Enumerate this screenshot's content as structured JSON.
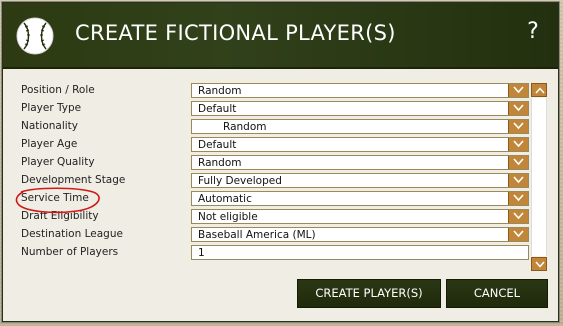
{
  "dialog": {
    "title": "CREATE FICTIONAL PLAYER(S)",
    "help_label": "?"
  },
  "fields": [
    {
      "label": "Position / Role",
      "value": "Random",
      "kind": "select"
    },
    {
      "label": "Player Type",
      "value": "Default",
      "kind": "select"
    },
    {
      "label": "Nationality",
      "value": "Random",
      "kind": "select"
    },
    {
      "label": "Player Age",
      "value": "Default",
      "kind": "select"
    },
    {
      "label": "Player Quality",
      "value": "Random",
      "kind": "select"
    },
    {
      "label": "Development Stage",
      "value": "Fully Developed",
      "kind": "select"
    },
    {
      "label": "Service Time",
      "value": "Automatic",
      "kind": "select"
    },
    {
      "label": "Draft Eligibility",
      "value": "Not eligible",
      "kind": "select"
    },
    {
      "label": "Destination League",
      "value": "Baseball America (ML)",
      "kind": "select"
    },
    {
      "label": "Number of Players",
      "value": "1",
      "kind": "text"
    }
  ],
  "buttons": {
    "create_label": "CREATE PLAYER(S)",
    "cancel_label": "CANCEL"
  },
  "icons": {
    "title": "baseball-icon",
    "dropdown": "chevron-down-icon",
    "scroll_up": "chevron-up-icon",
    "scroll_down": "chevron-down-icon"
  },
  "colors": {
    "titlebar": "#2d3a12",
    "dropdown_arrow": "#c1863a",
    "button": "#2b3713",
    "annotation": "#d01818"
  }
}
